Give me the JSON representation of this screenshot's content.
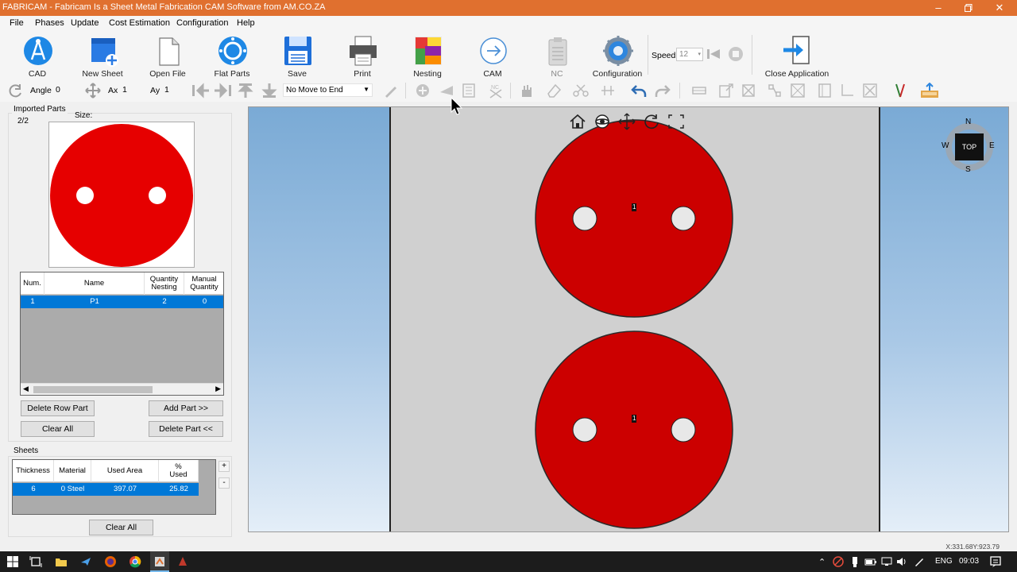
{
  "window": {
    "title": "FABRICAM - Fabricam Is a Sheet Metal Fabrication CAM Software from AM.CO.ZA"
  },
  "menu": [
    "File",
    "Phases",
    "Update",
    "Cost Estimation",
    "Configuration",
    "Help"
  ],
  "toolbar": {
    "buttons": [
      {
        "label": "CAD",
        "icon": "cad-compass-icon",
        "enabled": true
      },
      {
        "label": "New Sheet",
        "icon": "new-sheet-icon",
        "enabled": true
      },
      {
        "label": "Open File",
        "icon": "open-file-icon",
        "enabled": true
      },
      {
        "label": "Flat Parts",
        "icon": "flat-parts-icon",
        "enabled": true
      },
      {
        "label": "Save",
        "icon": "save-icon",
        "enabled": true
      },
      {
        "label": "Print",
        "icon": "print-icon",
        "enabled": true
      },
      {
        "label": "Nesting",
        "icon": "nesting-icon",
        "enabled": true
      },
      {
        "label": "CAM",
        "icon": "cam-icon",
        "enabled": true
      },
      {
        "label": "NC",
        "icon": "nc-icon",
        "enabled": false
      },
      {
        "label": "Configuration",
        "icon": "gear-icon",
        "enabled": true
      },
      {
        "label": "Close Application",
        "icon": "exit-icon",
        "enabled": true
      }
    ],
    "speed_label": "Speed",
    "speed_value": "12"
  },
  "toolbar2": {
    "angle_label": "Angle",
    "angle_value": "0",
    "ax_label": "Ax",
    "ax_value": "1",
    "ay_label": "Ay",
    "ay_value": "1",
    "move_option": "No Move to End"
  },
  "imported_parts": {
    "title": "Imported Parts",
    "counter": "2/2",
    "size_label": "Size:",
    "columns": [
      "Num.",
      "Name",
      "Quantity Nesting",
      "Manual Quantity"
    ],
    "rows": [
      {
        "num": "1",
        "name": "P1",
        "qty_nesting": "2",
        "manual_qty": "0"
      }
    ],
    "buttons": {
      "delete_row": "Delete Row Part",
      "add_part": "Add Part >>",
      "clear_all": "Clear All",
      "delete_part": "Delete Part <<"
    }
  },
  "sheets": {
    "title": "Sheets",
    "columns": [
      "Thickness",
      "Material",
      "Used Area",
      "% Used"
    ],
    "rows": [
      {
        "thickness": "6",
        "material": "0 Steel",
        "used_area": "397.07",
        "pct_used": "25.82"
      }
    ],
    "plus": "+",
    "minus": "-",
    "clear_all": "Clear All"
  },
  "viewport": {
    "compass": {
      "top": "TOP",
      "n": "N",
      "s": "S",
      "e": "E",
      "w": "W"
    },
    "part_labels": [
      "1",
      "1"
    ],
    "part_color": "#cc0000",
    "sheet_color": "#d0d0d0"
  },
  "status": {
    "coords": "X:331.68Y:923.79"
  },
  "taskbar": {
    "lang": "ENG",
    "time": "09:03"
  }
}
